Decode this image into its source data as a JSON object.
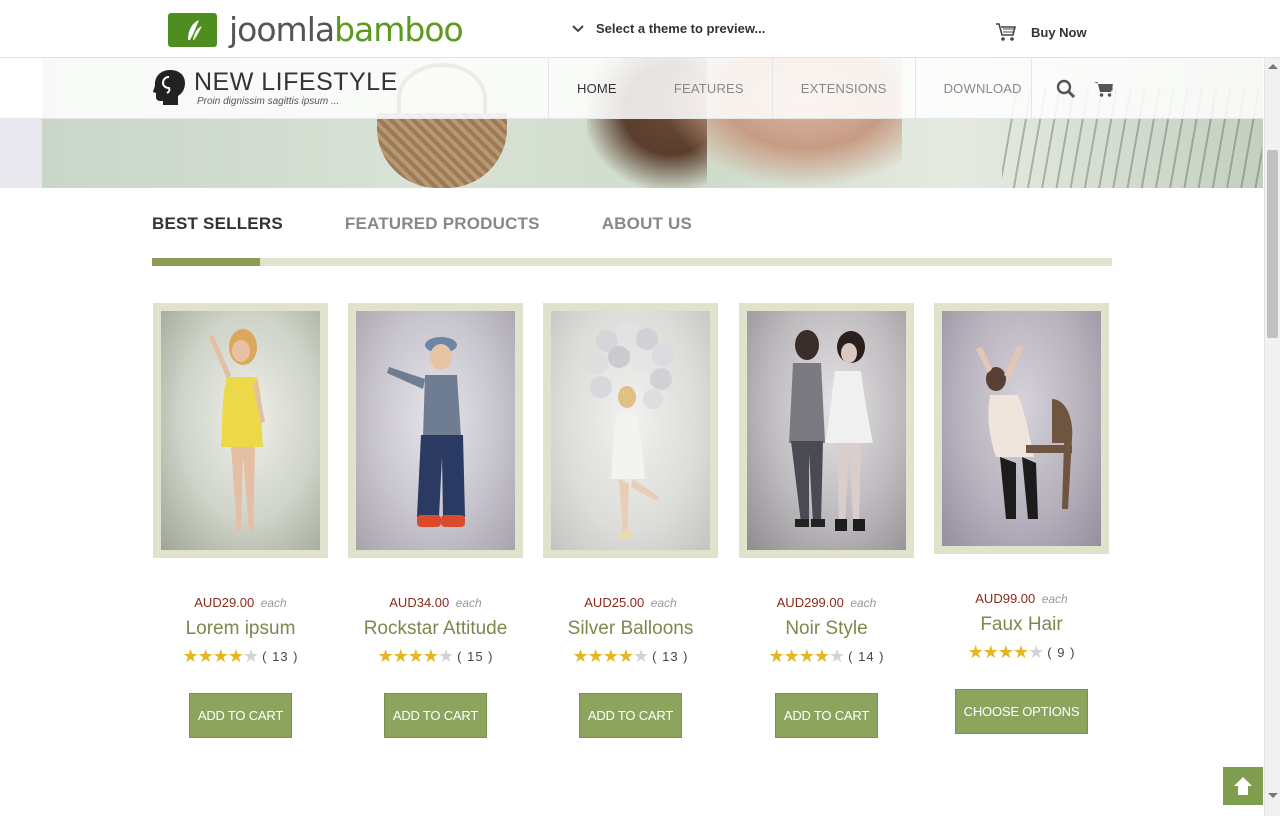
{
  "topbar": {
    "logo_part1": "joomla",
    "logo_part2": "bamboo",
    "theme_select": "Select a theme to preview...",
    "buy_now": "Buy Now"
  },
  "site": {
    "name": "NEW LIFESTYLE",
    "tagline": "Proin dignissim sagittis ipsum ..."
  },
  "menu": [
    "HOME",
    "FEATURES",
    "EXTENSIONS",
    "DOWNLOAD"
  ],
  "menu_active": "HOME",
  "tabs": [
    "BEST SELLERS",
    "FEATURED PRODUCTS",
    "ABOUT US"
  ],
  "active_tab": "BEST SELLERS",
  "products": [
    {
      "price": "AUD29.00",
      "each": "each",
      "name": "Lorem ipsum",
      "rating": 4,
      "reviews": "( 13 )",
      "button": "ADD TO CART"
    },
    {
      "price": "AUD34.00",
      "each": "each",
      "name": "Rockstar Attitude",
      "rating": 4,
      "reviews": "( 15 )",
      "button": "ADD TO CART"
    },
    {
      "price": "AUD25.00",
      "each": "each",
      "name": "Silver Balloons",
      "rating": 4,
      "reviews": "( 13 )",
      "button": "ADD TO CART"
    },
    {
      "price": "AUD299.00",
      "each": "each",
      "name": "Noir Style",
      "rating": 4,
      "reviews": "( 14 )",
      "button": "ADD TO CART"
    },
    {
      "price": "AUD99.00",
      "each": "each",
      "name": "Faux Hair",
      "rating": 4,
      "reviews": "( 9 )",
      "button": "CHOOSE OPTIONS"
    }
  ],
  "colors": {
    "accent_green": "#8ca45e",
    "price_red": "#8b2a1a",
    "product_name_green": "#7a8a4e",
    "frame_beige": "#e0e2cc",
    "star_gold": "#e3b623"
  },
  "icons": [
    "chevron-down-icon",
    "cart-icon",
    "search-icon",
    "shopping-cart-icon",
    "arrow-up-icon",
    "bamboo-leaf-icon",
    "head-silhouette-icon"
  ]
}
